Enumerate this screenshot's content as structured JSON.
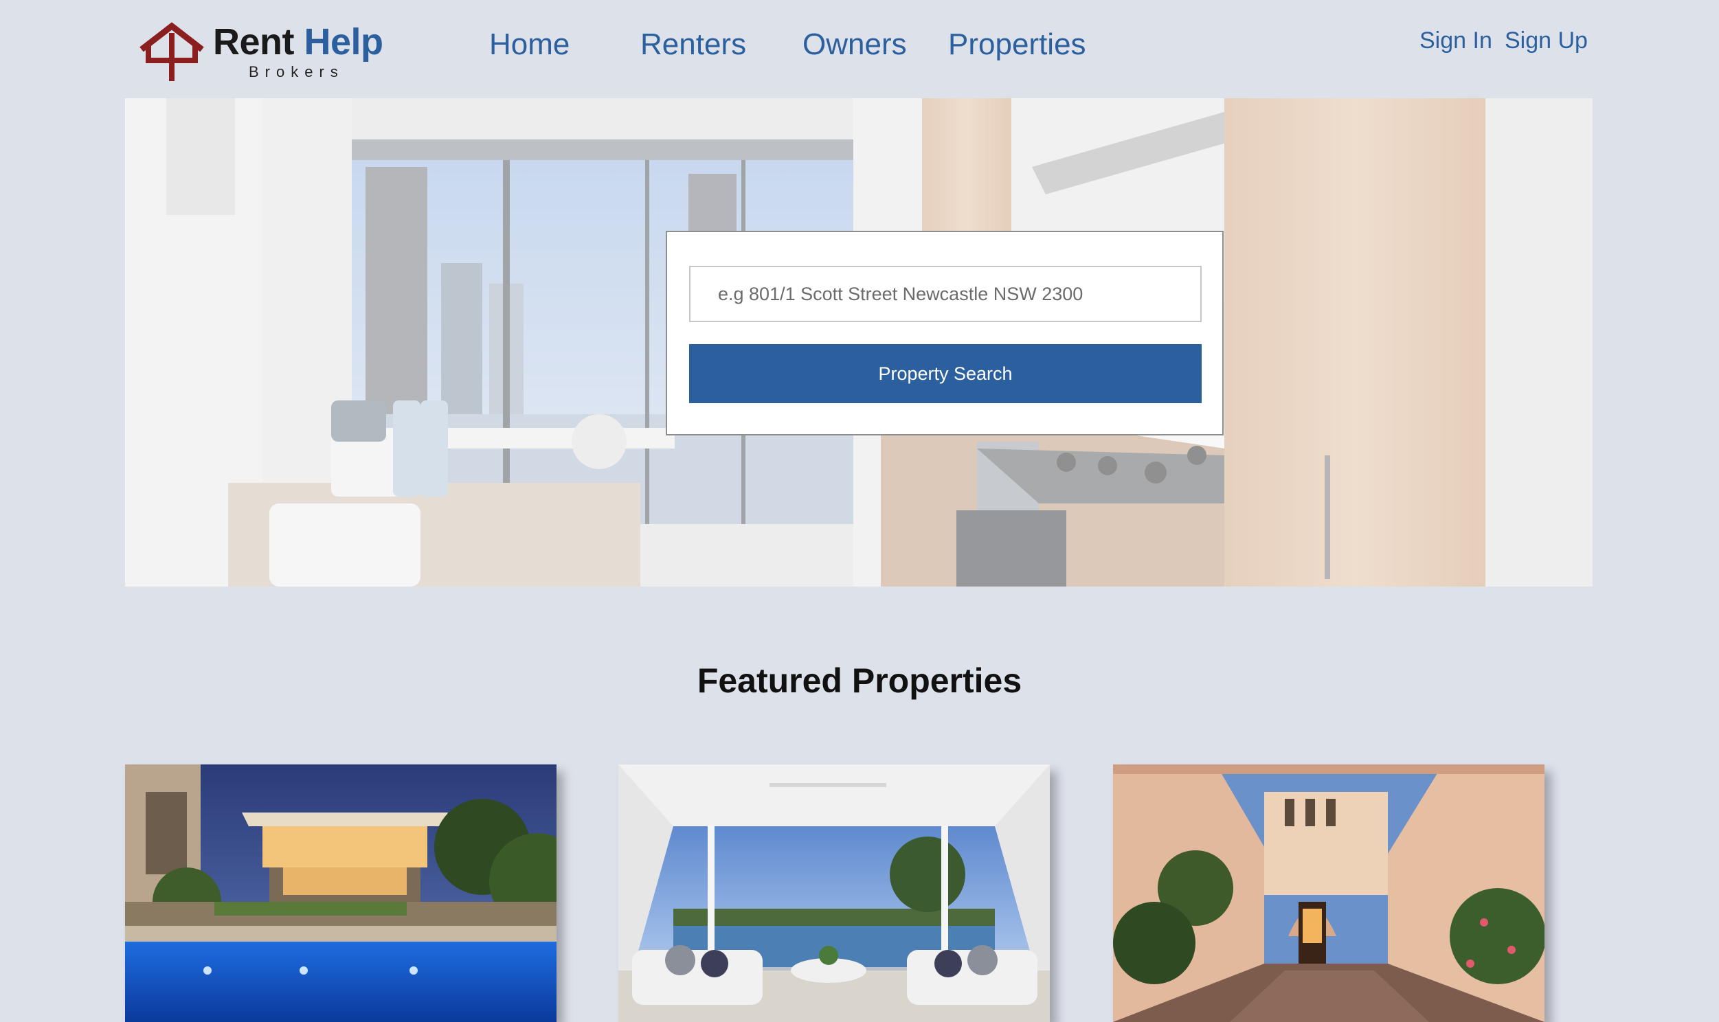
{
  "brand": {
    "name_part1": "Rent",
    "name_part2": "Help",
    "subtitle": "Brokers",
    "primary_color": "#2c5f9e",
    "logo_icon_color": "#8b1e1e"
  },
  "nav": {
    "items": [
      {
        "label": "Home"
      },
      {
        "label": "Renters"
      },
      {
        "label": "Owners"
      },
      {
        "label": "Properties"
      }
    ]
  },
  "auth": {
    "sign_in": "Sign In",
    "sign_up": "Sign Up"
  },
  "search": {
    "placeholder": "e.g 801/1 Scott Street Newcastle NSW 2300",
    "button_label": "Property Search"
  },
  "featured": {
    "title": "Featured Properties"
  }
}
